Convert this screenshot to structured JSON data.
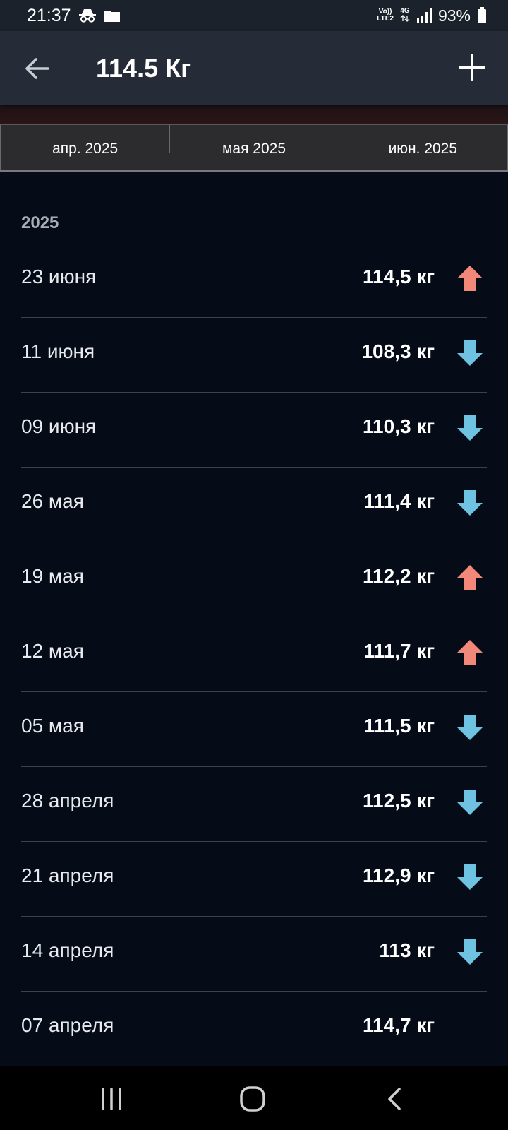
{
  "status_bar": {
    "time": "21:37",
    "net_top": "Vo))",
    "net_bottom": "LTE2",
    "gen": "4G",
    "battery": "93%"
  },
  "app_bar": {
    "title": "114.5 Кг"
  },
  "tabs": [
    "апр. 2025",
    "мая 2025",
    "июн. 2025"
  ],
  "list": {
    "year": "2025",
    "entries": [
      {
        "date": "23 июня",
        "weight": "114,5 кг",
        "trend": "up"
      },
      {
        "date": "11 июня",
        "weight": "108,3 кг",
        "trend": "down"
      },
      {
        "date": "09 июня",
        "weight": "110,3 кг",
        "trend": "down"
      },
      {
        "date": "26 мая",
        "weight": "111,4 кг",
        "trend": "down"
      },
      {
        "date": "19 мая",
        "weight": "112,2 кг",
        "trend": "up"
      },
      {
        "date": "12 мая",
        "weight": "111,7 кг",
        "trend": "up"
      },
      {
        "date": "05 мая",
        "weight": "111,5 кг",
        "trend": "down"
      },
      {
        "date": "28 апреля",
        "weight": "112,5 кг",
        "trend": "down"
      },
      {
        "date": "21 апреля",
        "weight": "112,9 кг",
        "trend": "down"
      },
      {
        "date": "14 апреля",
        "weight": "113 кг",
        "trend": "down"
      },
      {
        "date": "07 апреля",
        "weight": "114,7 кг",
        "trend": "none"
      }
    ]
  },
  "colors": {
    "up": "#f2887a",
    "down": "#6ec3e3",
    "background": "#050b17"
  }
}
